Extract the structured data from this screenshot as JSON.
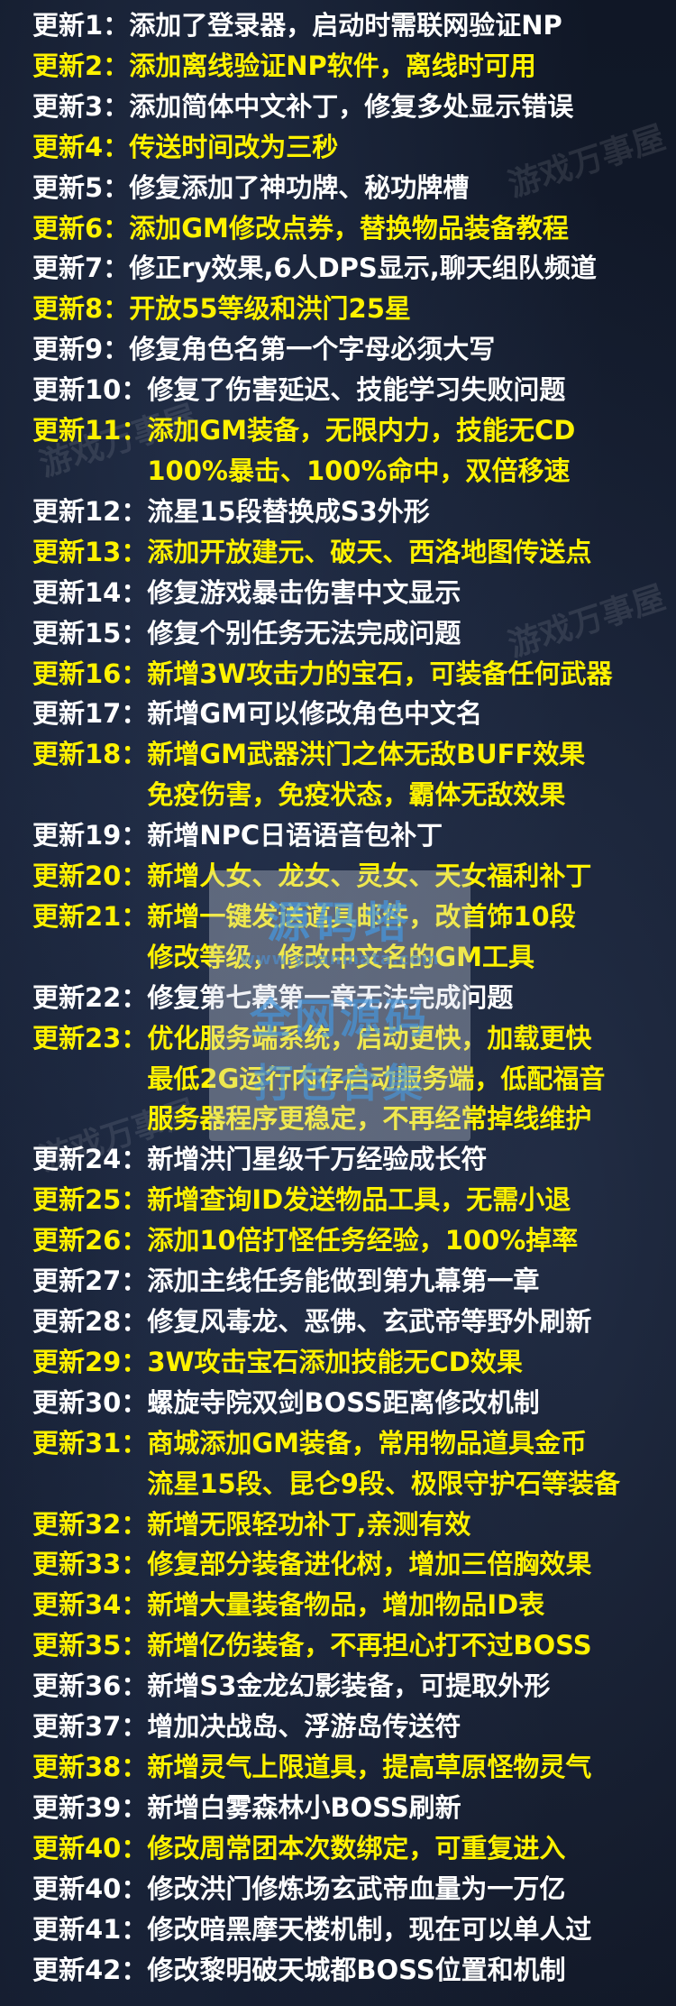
{
  "entries": [
    {
      "label": "更新1：",
      "color": "white",
      "lines": [
        "添加了登录器，启动时需联网验证NP"
      ]
    },
    {
      "label": "更新2：",
      "color": "yellow",
      "lines": [
        "添加离线验证NP软件，离线时可用"
      ]
    },
    {
      "label": "更新3：",
      "color": "white",
      "lines": [
        "添加简体中文补丁，修复多处显示错误"
      ]
    },
    {
      "label": "更新4：",
      "color": "yellow",
      "lines": [
        "传送时间改为三秒"
      ]
    },
    {
      "label": "更新5：",
      "color": "white",
      "lines": [
        "修复添加了神功牌、秘功牌槽"
      ]
    },
    {
      "label": "更新6：",
      "color": "yellow",
      "lines": [
        "添加GM修改点券，替换物品装备教程"
      ]
    },
    {
      "label": "更新7：",
      "color": "white",
      "lines": [
        "修正ry效果,6人DPS显示,聊天组队频道"
      ]
    },
    {
      "label": "更新8：",
      "color": "yellow",
      "lines": [
        "开放55等级和洪门25星"
      ]
    },
    {
      "label": "更新9：",
      "color": "white",
      "lines": [
        "修复角色名第一个字母必须大写"
      ]
    },
    {
      "label": "更新10：",
      "color": "white",
      "lines": [
        "修复了伤害延迟、技能学习失败问题"
      ]
    },
    {
      "label": "更新11：",
      "color": "yellow",
      "lines": [
        "添加GM装备，无限内力，技能无CD",
        "100%暴击、100%命中，双倍移速"
      ]
    },
    {
      "label": "更新12：",
      "color": "white",
      "lines": [
        "流星15段替换成S3外形"
      ]
    },
    {
      "label": "更新13：",
      "color": "yellow",
      "lines": [
        "添加开放建元、破天、西洛地图传送点"
      ]
    },
    {
      "label": "更新14：",
      "color": "white",
      "lines": [
        "修复游戏暴击伤害中文显示"
      ]
    },
    {
      "label": "更新15：",
      "color": "white",
      "lines": [
        "修复个别任务无法完成问题"
      ]
    },
    {
      "label": "更新16：",
      "color": "yellow",
      "lines": [
        "新增3W攻击力的宝石，可装备任何武器"
      ]
    },
    {
      "label": "更新17：",
      "color": "white",
      "lines": [
        "新增GM可以修改角色中文名"
      ]
    },
    {
      "label": "更新18：",
      "color": "yellow",
      "lines": [
        "新增GM武器洪门之体无敌BUFF效果",
        "免疫伤害，免疫状态，霸体无敌效果"
      ]
    },
    {
      "label": "更新19：",
      "color": "white",
      "lines": [
        "新增NPC日语语音包补丁"
      ]
    },
    {
      "label": "更新20：",
      "color": "yellow",
      "lines": [
        "新增人女、龙女、灵女、天女福利补丁"
      ]
    },
    {
      "label": "更新21：",
      "color": "yellow",
      "lines": [
        "新增一键发送道具邮件，改首饰10段",
        "修改等级，修改中文名的GM工具"
      ]
    },
    {
      "label": "更新22：",
      "color": "white",
      "lines": [
        "修复第七幕第一章无法完成问题"
      ]
    },
    {
      "label": "更新23：",
      "color": "yellow",
      "lines": [
        "优化服务端系统，启动更快，加载更快",
        "最低2G运行内存启动服务端，低配福音",
        "服务器程序更稳定，不再经常掉线维护"
      ]
    },
    {
      "label": "更新24：",
      "color": "white",
      "lines": [
        "新增洪门星级千万经验成长符"
      ]
    },
    {
      "label": "更新25：",
      "color": "yellow",
      "lines": [
        "新增查询ID发送物品工具，无需小退"
      ]
    },
    {
      "label": "更新26：",
      "color": "yellow",
      "lines": [
        "添加10倍打怪任务经验，100%掉率"
      ]
    },
    {
      "label": "更新27：",
      "color": "white",
      "lines": [
        "添加主线任务能做到第九幕第一章"
      ]
    },
    {
      "label": "更新28：",
      "color": "white",
      "lines": [
        "修复风毒龙、恶佛、玄武帝等野外刷新"
      ]
    },
    {
      "label": "更新29：",
      "color": "yellow",
      "lines": [
        "3W攻击宝石添加技能无CD效果"
      ]
    },
    {
      "label": "更新30：",
      "color": "white",
      "lines": [
        "螺旋寺院双剑BOSS距离修改机制"
      ]
    },
    {
      "label": "更新31：",
      "color": "yellow",
      "lines": [
        "商城添加GM装备，常用物品道具金币",
        "流星15段、昆仑9段、极限守护石等装备"
      ]
    },
    {
      "label": "更新32：",
      "color": "yellow",
      "lines": [
        "新增无限轻功补丁,亲测有效"
      ]
    },
    {
      "label": "更新33：",
      "color": "yellow",
      "lines": [
        "修复部分装备进化树，增加三倍胸效果"
      ]
    },
    {
      "label": "更新34：",
      "color": "yellow",
      "lines": [
        "新增大量装备物品，增加物品ID表"
      ]
    },
    {
      "label": "更新35：",
      "color": "yellow",
      "lines": [
        "新增亿伤装备，不再担心打不过BOSS"
      ]
    },
    {
      "label": "更新36：",
      "color": "white",
      "lines": [
        "新增S3金龙幻影装备，可提取外形"
      ]
    },
    {
      "label": "更新37：",
      "color": "white",
      "lines": [
        "增加决战岛、浮游岛传送符"
      ]
    },
    {
      "label": "更新38：",
      "color": "yellow",
      "lines": [
        "新增灵气上限道具，提高草原怪物灵气"
      ]
    },
    {
      "label": "更新39：",
      "color": "white",
      "lines": [
        "新增白雾森林小BOSS刷新"
      ]
    },
    {
      "label": "更新40：",
      "color": "yellow",
      "lines": [
        "修改周常团本次数绑定，可重复进入"
      ]
    },
    {
      "label": "更新40：",
      "color": "white",
      "lines": [
        "修改洪门修炼场玄武帝血量为一万亿"
      ]
    },
    {
      "label": "更新41：",
      "color": "white",
      "lines": [
        "修改暗黑摩天楼机制，现在可以单人过"
      ]
    },
    {
      "label": "更新42：",
      "color": "white",
      "lines": [
        "修改黎明破天城都BOSS位置和机制"
      ]
    }
  ],
  "watermark": {
    "line1": "源码塔",
    "line2": "www.yuanmata.com",
    "line3": "全网源码",
    "line4": "打包合集"
  },
  "side_marks": [
    "游戏万事屋",
    "游戏万事屋",
    "游戏万事屋"
  ],
  "colors": {
    "background": "#0d1220",
    "white_text": "#ffffff",
    "yellow_text": "#fff200"
  }
}
